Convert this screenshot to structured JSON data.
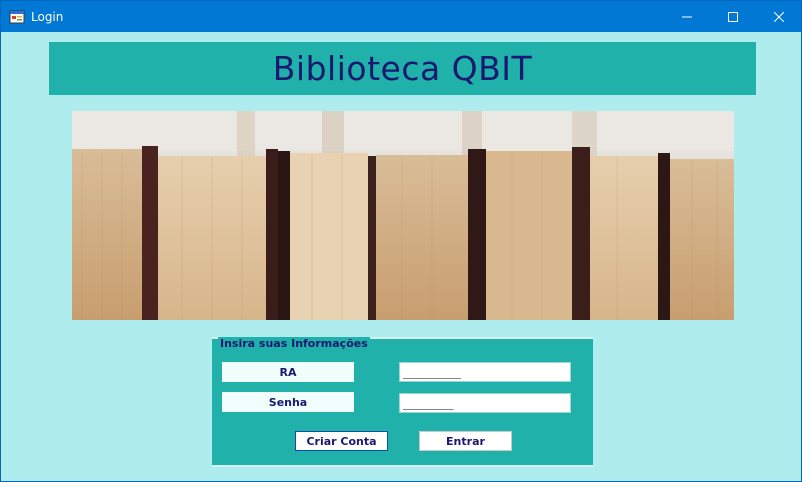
{
  "window": {
    "title": "Login",
    "icons": {
      "app": "app-form-icon",
      "minimize": "minimize-icon",
      "maximize": "maximize-icon",
      "close": "close-icon"
    }
  },
  "header": {
    "title": "Biblioteca QBIT"
  },
  "banner": {
    "image": "books-image"
  },
  "form": {
    "group_title": "Insira suas Informações",
    "ra_label": "RA",
    "ra_value": "________",
    "senha_label": "Senha",
    "senha_value": "_______",
    "create_button": "Criar Conta",
    "enter_button": "Entrar"
  },
  "colors": {
    "background": "#aeeced",
    "accent": "#20b2aa",
    "text": "#191970",
    "titlebar": "#0078d4"
  }
}
